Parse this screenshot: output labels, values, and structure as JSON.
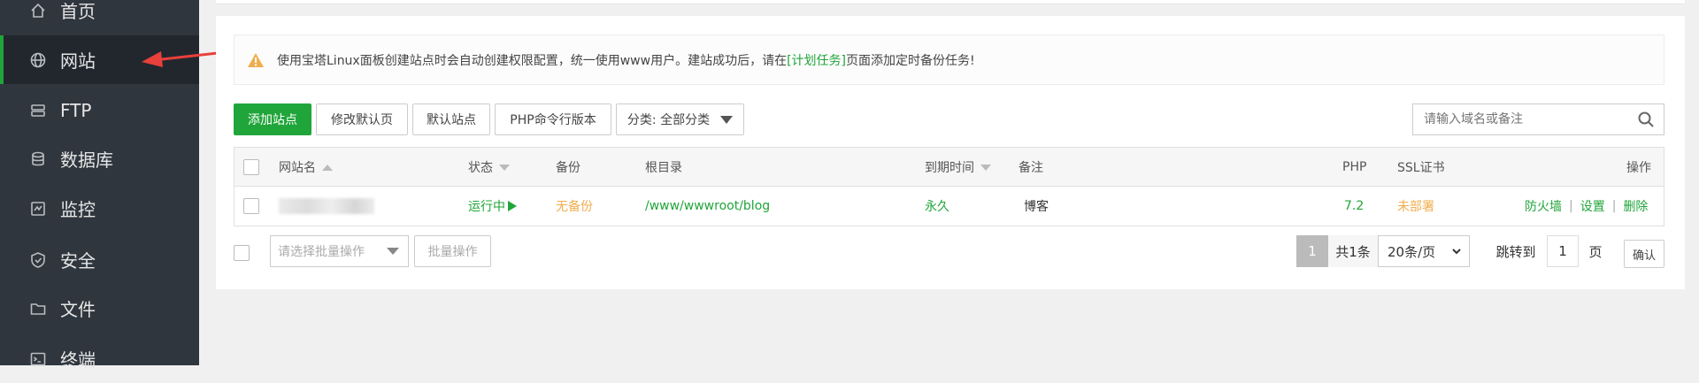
{
  "sidebar": {
    "items": [
      {
        "label": "首页",
        "icon": "home-icon"
      },
      {
        "label": "网站",
        "icon": "globe-icon",
        "active": true
      },
      {
        "label": "FTP",
        "icon": "ftp-icon"
      },
      {
        "label": "数据库",
        "icon": "database-icon"
      },
      {
        "label": "监控",
        "icon": "monitor-icon"
      },
      {
        "label": "安全",
        "icon": "shield-icon"
      },
      {
        "label": "文件",
        "icon": "folder-icon"
      },
      {
        "label": "终端",
        "icon": "terminal-icon"
      }
    ]
  },
  "notice": {
    "text_before": "使用宝塔Linux面板创建站点时会自动创建权限配置，统一使用www用户。建站成功后，请在",
    "link": "[计划任务]",
    "text_after": "页面添加定时备份任务!"
  },
  "toolbar": {
    "add_site": "添加站点",
    "edit_default": "修改默认页",
    "default_site": "默认站点",
    "php_cli": "PHP命令行版本",
    "category": "分类: 全部分类"
  },
  "search": {
    "placeholder": "请输入域名或备注"
  },
  "table": {
    "headers": {
      "name": "网站名",
      "status": "状态",
      "backup": "备份",
      "root": "根目录",
      "expire": "到期时间",
      "remark": "备注",
      "php": "PHP",
      "ssl": "SSL证书",
      "actions": "操作"
    },
    "rows": [
      {
        "status": "运行中",
        "backup": "无备份",
        "root": "/www/wwwroot/blog",
        "expire": "永久",
        "remark": "博客",
        "php": "7.2",
        "ssl": "未部署",
        "actions": [
          "防火墙",
          "设置",
          "删除"
        ]
      }
    ]
  },
  "footer": {
    "batch_placeholder": "请选择批量操作",
    "batch_button": "批量操作",
    "current_page": "1",
    "total": "共1条",
    "page_size": "20条/页",
    "jump_label": "跳转到",
    "jump_value": "1",
    "page_unit": "页",
    "confirm": "确认"
  },
  "colors": {
    "accent": "#20a53a",
    "sidebar_bg": "#30363e",
    "warning": "#f0ad4e"
  }
}
